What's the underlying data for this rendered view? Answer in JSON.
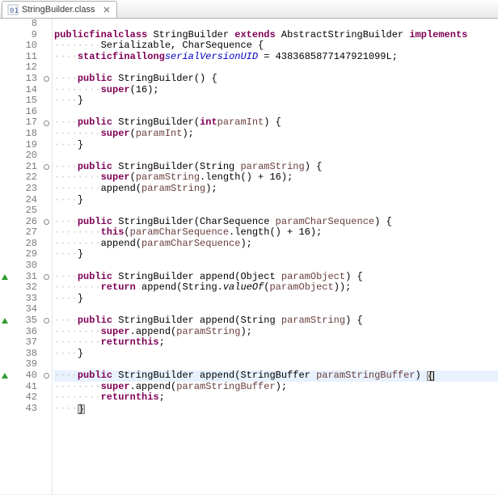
{
  "tab": {
    "title": "StringBuilder.class"
  },
  "lines": [
    {
      "n": 8,
      "marker": "",
      "fold": "",
      "html": ""
    },
    {
      "n": 9,
      "marker": "",
      "fold": "",
      "html": "<span class='kw'>public</span> <span class='kw'>final</span> <span class='kw'>class</span> StringBuilder <span class='kw'>extends</span> AbstractStringBuilder <span class='kw'>implements</span>"
    },
    {
      "n": 10,
      "marker": "",
      "fold": "",
      "html": "<span class='ws'>········</span>Serializable, CharSequence {"
    },
    {
      "n": 11,
      "marker": "",
      "fold": "",
      "html": "<span class='ws'>····</span><span class='kw'>static</span> <span class='kw'>final</span> <span class='kw'>long</span> <span class='fld'>serialVersionUID</span> = 4383685877147921099L;"
    },
    {
      "n": 12,
      "marker": "",
      "fold": "",
      "html": ""
    },
    {
      "n": 13,
      "marker": "",
      "fold": "circle",
      "html": "<span class='ws'>····</span><span class='kw'>public</span> StringBuilder() {"
    },
    {
      "n": 14,
      "marker": "",
      "fold": "",
      "html": "<span class='ws'>········</span><span class='kw'>super</span>(16);"
    },
    {
      "n": 15,
      "marker": "",
      "fold": "",
      "html": "<span class='ws'>····</span>}"
    },
    {
      "n": 16,
      "marker": "",
      "fold": "",
      "html": ""
    },
    {
      "n": 17,
      "marker": "",
      "fold": "circle",
      "html": "<span class='ws'>····</span><span class='kw'>public</span> StringBuilder(<span class='kw'>int</span> <span class='param'>paramInt</span>) {"
    },
    {
      "n": 18,
      "marker": "",
      "fold": "",
      "html": "<span class='ws'>········</span><span class='kw'>super</span>(<span class='param'>paramInt</span>);"
    },
    {
      "n": 19,
      "marker": "",
      "fold": "",
      "html": "<span class='ws'>····</span>}"
    },
    {
      "n": 20,
      "marker": "",
      "fold": "",
      "html": ""
    },
    {
      "n": 21,
      "marker": "",
      "fold": "circle",
      "html": "<span class='ws'>····</span><span class='kw'>public</span> StringBuilder(String <span class='param'>paramString</span>) {"
    },
    {
      "n": 22,
      "marker": "",
      "fold": "",
      "html": "<span class='ws'>········</span><span class='kw'>super</span>(<span class='param'>paramString</span>.length() + 16);"
    },
    {
      "n": 23,
      "marker": "",
      "fold": "",
      "html": "<span class='ws'>········</span>append(<span class='param'>paramString</span>);"
    },
    {
      "n": 24,
      "marker": "",
      "fold": "",
      "html": "<span class='ws'>····</span>}"
    },
    {
      "n": 25,
      "marker": "",
      "fold": "",
      "html": ""
    },
    {
      "n": 26,
      "marker": "",
      "fold": "circle",
      "html": "<span class='ws'>····</span><span class='kw'>public</span> StringBuilder(CharSequence <span class='param'>paramCharSequence</span>) {"
    },
    {
      "n": 27,
      "marker": "",
      "fold": "",
      "html": "<span class='ws'>········</span><span class='kw'>this</span>(<span class='param'>paramCharSequence</span>.length() + 16);"
    },
    {
      "n": 28,
      "marker": "",
      "fold": "",
      "html": "<span class='ws'>········</span>append(<span class='param'>paramCharSequence</span>);"
    },
    {
      "n": 29,
      "marker": "",
      "fold": "",
      "html": "<span class='ws'>····</span>}"
    },
    {
      "n": 30,
      "marker": "",
      "fold": "",
      "html": ""
    },
    {
      "n": 31,
      "marker": "override",
      "fold": "circle",
      "html": "<span class='ws'>····</span><span class='kw'>public</span> StringBuilder append(Object <span class='param'>paramObject</span>) {"
    },
    {
      "n": 32,
      "marker": "",
      "fold": "",
      "html": "<span class='ws'>········</span><span class='kw'>return</span> append(String.<span style='font-style:italic'>valueOf</span>(<span class='param'>paramObject</span>));"
    },
    {
      "n": 33,
      "marker": "",
      "fold": "",
      "html": "<span class='ws'>····</span>}"
    },
    {
      "n": 34,
      "marker": "",
      "fold": "",
      "html": ""
    },
    {
      "n": 35,
      "marker": "override",
      "fold": "circle",
      "html": "<span class='ws'>····</span><span class='kw'>public</span> StringBuilder append(String <span class='param'>paramString</span>) {"
    },
    {
      "n": 36,
      "marker": "",
      "fold": "",
      "html": "<span class='ws'>········</span><span class='kw'>super</span>.append(<span class='param'>paramString</span>);"
    },
    {
      "n": 37,
      "marker": "",
      "fold": "",
      "html": "<span class='ws'>········</span><span class='kw'>return</span> <span class='kw'>this</span>;"
    },
    {
      "n": 38,
      "marker": "",
      "fold": "",
      "html": "<span class='ws'>····</span>}"
    },
    {
      "n": 39,
      "marker": "",
      "fold": "",
      "html": ""
    },
    {
      "n": 40,
      "marker": "override",
      "fold": "circle",
      "hl": true,
      "html": "<span class='ws'>····</span><span class='kw'>public</span> StringBuilder append(StringBuffer <span class='param'>paramStringBuffer</span>) <span class='bracket-hl'>{</span><span class='caret'></span>"
    },
    {
      "n": 41,
      "marker": "",
      "fold": "",
      "html": "<span class='ws'>········</span><span class='kw'>super</span>.append(<span class='param'>paramStringBuffer</span>);"
    },
    {
      "n": 42,
      "marker": "",
      "fold": "",
      "html": "<span class='ws'>········</span><span class='kw'>return</span> <span class='kw'>this</span>;"
    },
    {
      "n": 43,
      "marker": "",
      "fold": "",
      "html": "<span class='ws'>····</span><span class='bracket-hl'>}</span>"
    }
  ]
}
